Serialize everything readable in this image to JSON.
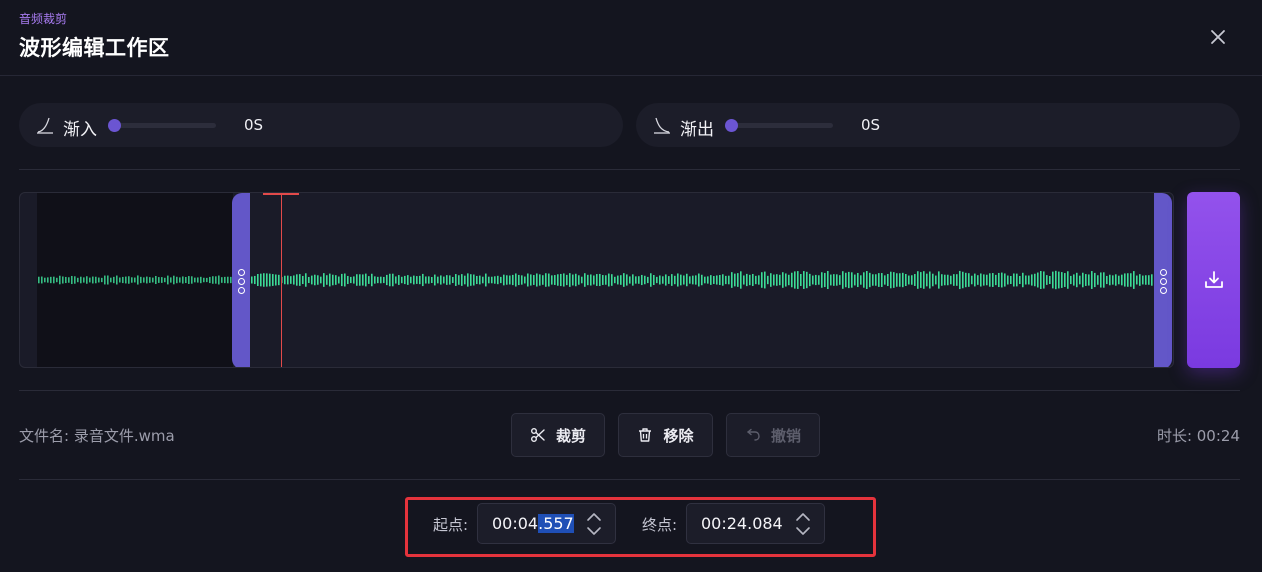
{
  "header": {
    "eyebrow": "音频裁剪",
    "title": "波形编辑工作区",
    "close_icon": "close-icon"
  },
  "fade_in": {
    "label": "渐入",
    "value": "0S",
    "level": 0
  },
  "fade_out": {
    "label": "渐出",
    "value": "0S",
    "level": 0
  },
  "waveform": {
    "wave_color": "#3ddc97",
    "selection_color": "#6357c8",
    "playhead_color": "#e24a4a",
    "selection_start_fraction": 0.19,
    "selection_end_fraction": 1.0
  },
  "download": {
    "icon": "download-icon"
  },
  "file": {
    "label": "文件名: 录音文件.wma"
  },
  "duration": {
    "label": "时长: 00:24"
  },
  "actions": {
    "cut_label": "裁剪",
    "remove_label": "移除",
    "undo_label": "撤销"
  },
  "time": {
    "start_label": "起点:",
    "start_value_prefix": "00:04",
    "start_value_selected": ".557",
    "end_label": "终点:",
    "end_value": "00:24.084"
  },
  "colors": {
    "accent": "#7a3ae0",
    "highlight_border": "#e5333c"
  }
}
